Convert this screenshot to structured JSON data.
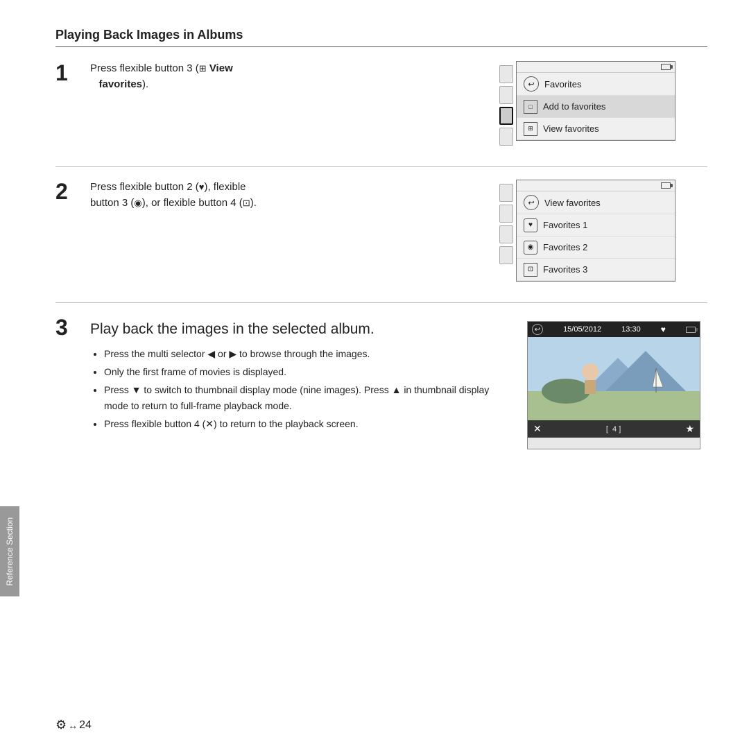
{
  "page": {
    "title": "Playing Back Images in Albums",
    "reference_section_label": "Reference Section",
    "footer_icon": "⚙",
    "footer_page": "24"
  },
  "step1": {
    "number": "1",
    "text_before": "Press flexible button 3 (",
    "icon_label": "🖼 View",
    "text_after": " View",
    "bold_text": "favorites",
    "text_close": ").",
    "full_text": "Press flexible button 3 (🖼 View favorites).",
    "screen": {
      "back_item": "Favorites",
      "items": [
        {
          "label": "Add to favorites"
        },
        {
          "label": "View favorites"
        }
      ]
    }
  },
  "step2": {
    "number": "2",
    "text": "Press flexible button 2 (♥), flexible button 3 (◉), or flexible button 4 (⊡).",
    "screen": {
      "back_item": "View favorites",
      "items": [
        {
          "label": "Favorites 1"
        },
        {
          "label": "Favorites 2"
        },
        {
          "label": "Favorites 3"
        }
      ]
    }
  },
  "step3": {
    "number": "3",
    "title": "Play back the images in the selected album.",
    "bullets": [
      "Press the multi selector ◀ or ▶ to browse through the images.",
      "Only the first frame of movies is displayed.",
      "Press ▼ to switch to thumbnail display mode (nine images). Press ▲ in thumbnail display mode to return to full-frame playback mode.",
      "Press flexible button 4 (✕) to return to the playback screen."
    ],
    "preview": {
      "timestamp": "15/05/2012",
      "time": "13:30",
      "frame_count": "4"
    }
  }
}
